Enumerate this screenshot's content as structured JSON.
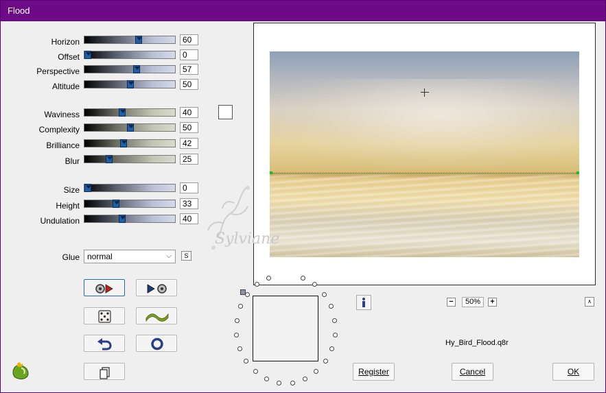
{
  "window": {
    "title": "Flood"
  },
  "sliders_group1": [
    {
      "label": "Horizon",
      "value": "60",
      "pct": 0.6,
      "style": "blue"
    },
    {
      "label": "Offset",
      "value": "0",
      "pct": 0.0,
      "style": "blue"
    },
    {
      "label": "Perspective",
      "value": "57",
      "pct": 0.57,
      "style": "blue"
    },
    {
      "label": "Altitude",
      "value": "50",
      "pct": 0.5,
      "style": "blue"
    }
  ],
  "sliders_group2": [
    {
      "label": "Waviness",
      "value": "40",
      "pct": 0.4,
      "style": "olive"
    },
    {
      "label": "Complexity",
      "value": "50",
      "pct": 0.5,
      "style": "olive"
    },
    {
      "label": "Brilliance",
      "value": "42",
      "pct": 0.42,
      "style": "olive"
    },
    {
      "label": "Blur",
      "value": "25",
      "pct": 0.25,
      "style": "olive"
    }
  ],
  "sliders_group3": [
    {
      "label": "Size",
      "value": "0",
      "pct": 0.0,
      "style": "blue"
    },
    {
      "label": "Height",
      "value": "33",
      "pct": 0.33,
      "style": "blue"
    },
    {
      "label": "Undulation",
      "value": "40",
      "pct": 0.4,
      "style": "blue"
    }
  ],
  "glue": {
    "label": "Glue",
    "value": "normal",
    "s_button": "S"
  },
  "color_swatch": "#ffffff",
  "watermark": "Sylviane",
  "preview": {
    "zoom": "50%",
    "filename": "Hy_Bird_Flood.q8r"
  },
  "buttons": {
    "register": "Register",
    "cancel": "Cancel",
    "ok": "OK"
  },
  "icons": {
    "load_preset": "load-preset-icon",
    "save_preset": "save-preset-icon",
    "randomize": "dice-icon",
    "wave": "wave-icon",
    "undo": "undo-icon",
    "reset": "reset-icon",
    "copy": "copy-icon",
    "info": "info-icon",
    "logo": "app-logo-icon"
  },
  "colors": {
    "titlebar": "#6d0a86",
    "accent": "#1a68c9"
  }
}
